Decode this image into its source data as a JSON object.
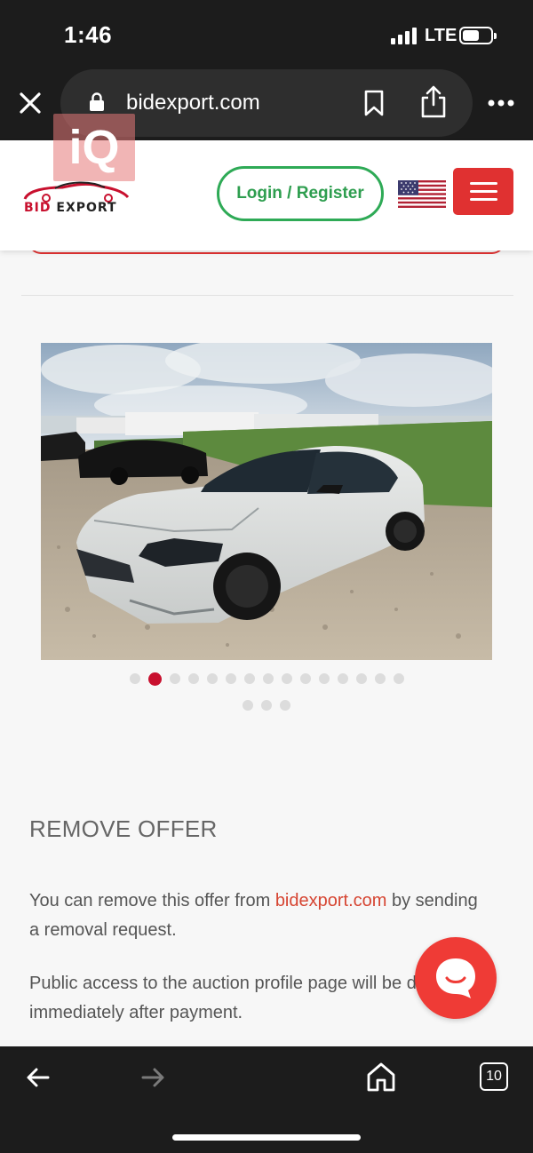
{
  "status_bar": {
    "time": "1:46",
    "network": "LTE"
  },
  "browser": {
    "url": "bidexport.com",
    "tab_count": "10"
  },
  "header": {
    "watermark": "iQ",
    "logo_text_1": "BID",
    "logo_text_2": "EXPORT",
    "login_label": "Login / Register",
    "accent_color": "#e03131",
    "login_color": "#2eaa56"
  },
  "gallery": {
    "dot_count_row1": 15,
    "dot_count_row2": 3,
    "active_index": 1
  },
  "content": {
    "remove_title": "REMOVE OFFER",
    "para1_before": "You can remove this offer from ",
    "para1_link": "bidexport.com",
    "para1_after": " by sending a removal request.",
    "para2": "Public access to the auction profile page will be disabled immediately after payment."
  }
}
